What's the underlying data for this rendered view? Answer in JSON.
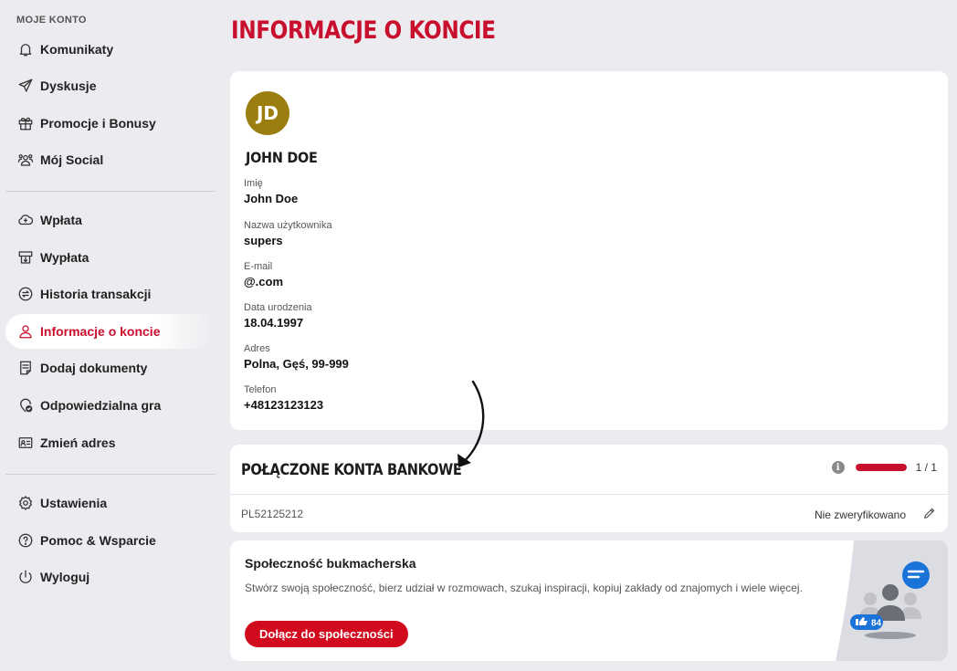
{
  "sidebar": {
    "heading": "MOJE KONTO",
    "items": [
      {
        "label": "Komunikaty",
        "icon": "bell-icon"
      },
      {
        "label": "Dyskusje",
        "icon": "paper-plane-icon"
      },
      {
        "label": "Promocje i Bonusy",
        "icon": "gift-icon"
      },
      {
        "label": "Mój Social",
        "icon": "users-icon"
      },
      {
        "label": "Wpłata",
        "icon": "deposit-icon"
      },
      {
        "label": "Wypłata",
        "icon": "withdraw-icon"
      },
      {
        "label": "Historia transakcji",
        "icon": "history-icon"
      },
      {
        "label": "Informacje o koncie",
        "icon": "user-icon",
        "active": true
      },
      {
        "label": "Dodaj dokumenty",
        "icon": "document-icon"
      },
      {
        "label": "Odpowiedzialna gra",
        "icon": "shield-check-icon"
      },
      {
        "label": "Zmień adres",
        "icon": "address-card-icon"
      },
      {
        "label": "Ustawienia",
        "icon": "gear-icon"
      },
      {
        "label": "Pomoc & Wsparcie",
        "icon": "help-icon"
      },
      {
        "label": "Wyloguj",
        "icon": "power-icon"
      }
    ]
  },
  "page": {
    "title": "INFORMACJE O KONCIE"
  },
  "profile": {
    "initials": "JD",
    "name": "JOHN DOE",
    "fields": [
      {
        "label": "Imię",
        "value": "John Doe"
      },
      {
        "label": "Nazwa użytkownika",
        "value": "supers"
      },
      {
        "label": "E-mail",
        "value": "@.com"
      },
      {
        "label": "Data urodzenia",
        "value": "18.04.1997"
      },
      {
        "label": "Adres",
        "value": "Polna, Gęś, 99-999"
      },
      {
        "label": "Telefon",
        "value": "+48123123123"
      }
    ]
  },
  "bank": {
    "title": "POŁĄCZONE KONTA BANKOWE",
    "info_glyph": "i",
    "progress_fraction": 1.0,
    "count": "1 / 1",
    "account": "PL52125212",
    "status": "Nie zweryfikowano"
  },
  "social": {
    "title": "Społeczność bukmacherska",
    "description": "Stwórz swoją społeczność, bierz udział w rozmowach, szukaj inspiracji, kopiuj zakłady od znajomych i wiele więcej.",
    "button": "Dołącz do społeczności",
    "likes": "84"
  },
  "colors": {
    "accent": "#c8102e",
    "avatar": "#9c7d0f",
    "chat_bubble": "#1a73d9"
  }
}
